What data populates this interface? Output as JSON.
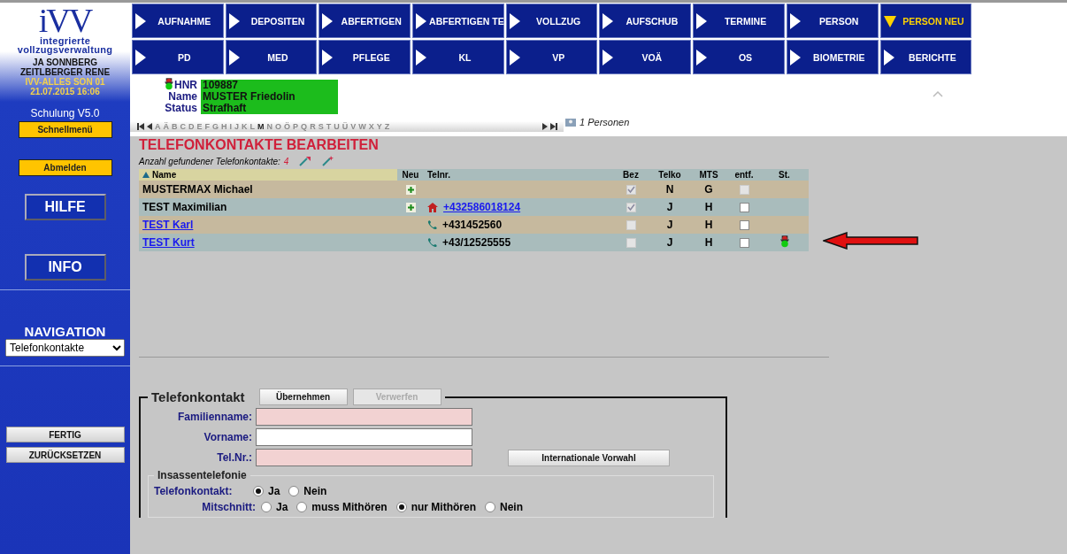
{
  "logo": {
    "mark": "iVV",
    "line_1": "integrierte",
    "line_2": "vollzugsverwaltung"
  },
  "sidebar": {
    "user_lines": [
      "JA SONNBERG",
      "ZEITLBERGER RENE"
    ],
    "session_lines": [
      "IVV-ALLES SON 01",
      "21.07.2015 16:06"
    ],
    "version": "Schulung V5.0",
    "quick_button": "Schnellmenü",
    "logout_button": "Abmelden",
    "help_button": "HILFE",
    "info_button": "INFO",
    "navigation_label": "NAVIGATION",
    "navigation_select": "Telefonkontakte",
    "done_button": "FERTIG",
    "reset_button": "ZURÜCKSETZEN"
  },
  "top_nav": [
    {
      "label": "AUFNAHME",
      "selected": false
    },
    {
      "label": "DEPOSITEN",
      "selected": false
    },
    {
      "label": "ABFERTIGEN",
      "selected": false
    },
    {
      "label": "ABFERTIGEN TE",
      "selected": false
    },
    {
      "label": "VOLLZUG",
      "selected": false
    },
    {
      "label": "AUFSCHUB",
      "selected": false
    },
    {
      "label": "TERMINE",
      "selected": false
    },
    {
      "label": "PERSON",
      "selected": false
    },
    {
      "label": "PERSON NEU",
      "selected": true
    },
    {
      "label": "PD",
      "selected": false
    },
    {
      "label": "MED",
      "selected": false
    },
    {
      "label": "PFLEGE",
      "selected": false
    },
    {
      "label": "KL",
      "selected": false
    },
    {
      "label": "VP",
      "selected": false
    },
    {
      "label": "VOÄ",
      "selected": false
    },
    {
      "label": "OS",
      "selected": false
    },
    {
      "label": "BIOMETRIE",
      "selected": false
    },
    {
      "label": "BERICHTE",
      "selected": false
    }
  ],
  "person": {
    "fields": [
      {
        "label": "HNR",
        "value": "109887"
      },
      {
        "label": "Name",
        "value": "MUSTER Friedolin"
      },
      {
        "label": "Status",
        "value": "Strafhaft"
      }
    ],
    "count": "1 Personen"
  },
  "letters": [
    {
      "label": "A",
      "selected": false
    },
    {
      "label": "Ä",
      "selected": false
    },
    {
      "label": "B",
      "selected": false
    },
    {
      "label": "C",
      "selected": false
    },
    {
      "label": "D",
      "selected": false
    },
    {
      "label": "E",
      "selected": false
    },
    {
      "label": "F",
      "selected": false
    },
    {
      "label": "G",
      "selected": false
    },
    {
      "label": "H",
      "selected": false
    },
    {
      "label": "I",
      "selected": false
    },
    {
      "label": "J",
      "selected": false
    },
    {
      "label": "K",
      "selected": false
    },
    {
      "label": "L",
      "selected": false
    },
    {
      "label": "M",
      "selected": true
    },
    {
      "label": "N",
      "selected": false
    },
    {
      "label": "O",
      "selected": false
    },
    {
      "label": "Ö",
      "selected": false
    },
    {
      "label": "P",
      "selected": false
    },
    {
      "label": "Q",
      "selected": false
    },
    {
      "label": "R",
      "selected": false
    },
    {
      "label": "S",
      "selected": false
    },
    {
      "label": "T",
      "selected": false
    },
    {
      "label": "U",
      "selected": false
    },
    {
      "label": "Ü",
      "selected": false
    },
    {
      "label": "V",
      "selected": false
    },
    {
      "label": "W",
      "selected": false
    },
    {
      "label": "X",
      "selected": false
    },
    {
      "label": "Y",
      "selected": false
    },
    {
      "label": "Z",
      "selected": false
    }
  ],
  "page_title": "TELEFONKONTAKTE BEARBEITEN",
  "found": {
    "label": "Anzahl gefundener Telefonkontakte:",
    "count": "4"
  },
  "table": {
    "columns": [
      "Name",
      "Neu",
      "Telnr.",
      "Bez",
      "Telko",
      "MTS",
      "entf.",
      "St."
    ],
    "rows": [
      {
        "name": "MUSTERMAX Michael",
        "link": false,
        "new": true,
        "bez": {
          "checked": true,
          "disabled": true
        },
        "telko": "N",
        "mts": "G",
        "entf": {
          "checked": false,
          "disabled": true
        },
        "status": false
      },
      {
        "name": "TEST Maximilian",
        "link": false,
        "new": true,
        "phone": {
          "kind": "home",
          "number": "+432586018124",
          "link": true
        },
        "bez": {
          "checked": true,
          "disabled": true
        },
        "telko": "J",
        "mts": "H",
        "entf": {
          "checked": false,
          "disabled": false
        },
        "status": false
      },
      {
        "name": "TEST Karl",
        "link": true,
        "new": false,
        "phone": {
          "kind": "handset",
          "number": "+431452560",
          "link": false
        },
        "bez": {
          "checked": false,
          "disabled": true
        },
        "telko": "J",
        "mts": "H",
        "entf": {
          "checked": false,
          "disabled": false
        },
        "status": false
      },
      {
        "name": "TEST Kurt",
        "link": true,
        "new": false,
        "phone": {
          "kind": "handset",
          "number": "+43/12525555",
          "link": false
        },
        "bez": {
          "checked": false,
          "disabled": true
        },
        "telko": "J",
        "mts": "H",
        "entf": {
          "checked": false,
          "disabled": false
        },
        "status": true
      }
    ]
  },
  "form": {
    "legend": "Telefonkontakt",
    "apply_button": {
      "label": "Übernehmen",
      "disabled": false
    },
    "discard_button": {
      "label": "Verwerfen",
      "disabled": true
    },
    "fields": [
      {
        "label": "Familienname:",
        "required": true
      },
      {
        "label": "Vorname:",
        "required": false
      },
      {
        "label": "Tel.Nr.:",
        "required": true
      }
    ],
    "prefix_button": "Internationale Vorwahl",
    "inmate_phone": {
      "legend": "Insassentelefonie",
      "groups": [
        {
          "label": "Telefonkontakt:",
          "options": [
            {
              "label": "Ja",
              "selected": true
            },
            {
              "label": "Nein",
              "selected": false
            }
          ]
        },
        {
          "label": "Mitschnitt:",
          "options": [
            {
              "label": "Ja",
              "selected": false
            },
            {
              "label": "muss Mithören",
              "selected": false
            },
            {
              "label": "nur Mithören",
              "selected": true
            },
            {
              "label": "Nein",
              "selected": false
            }
          ]
        }
      ]
    }
  }
}
